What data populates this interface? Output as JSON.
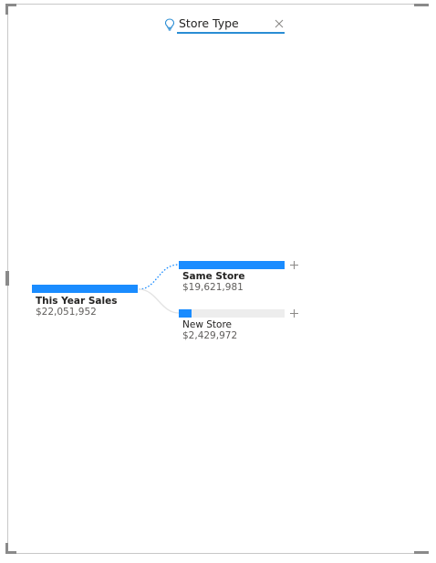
{
  "header": {
    "title": "Store Type",
    "icon": "lightbulb-icon",
    "accent_color": "#2a8dd4"
  },
  "root": {
    "label": "This Year Sales",
    "value": "$22,051,952",
    "fill_fraction": 1.0
  },
  "children": [
    {
      "label": "Same Store",
      "value": "$19,621,981",
      "fill_fraction": 1.0,
      "selected": true
    },
    {
      "label": "New Store",
      "value": "$2,429,972",
      "fill_fraction": 0.124,
      "selected": false
    }
  ],
  "colors": {
    "bar_fill": "#1a8cff",
    "bar_track": "#ededed",
    "connector": "#1a8cff"
  }
}
